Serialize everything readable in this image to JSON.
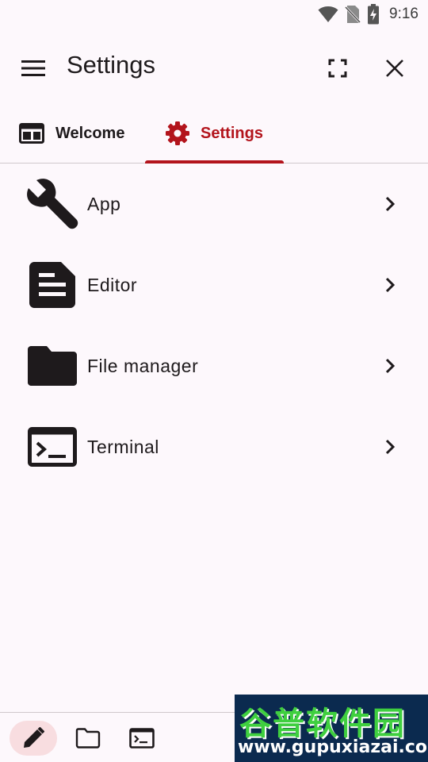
{
  "status_bar": {
    "time": "9:16",
    "icons": [
      "wifi-icon",
      "no-sim-icon",
      "battery-charging-icon"
    ]
  },
  "app_bar": {
    "title": "Settings",
    "icons": [
      "menu-icon",
      "fullscreen-icon",
      "close-icon"
    ]
  },
  "tabs": [
    {
      "label": "Welcome",
      "icon": "welcome-window-icon",
      "selected": false
    },
    {
      "label": "Settings",
      "icon": "gear-icon",
      "selected": true
    }
  ],
  "settings_items": [
    {
      "label": "App",
      "icon": "wrench-icon"
    },
    {
      "label": "Editor",
      "icon": "document-icon"
    },
    {
      "label": "File manager",
      "icon": "folder-icon"
    },
    {
      "label": "Terminal",
      "icon": "terminal-icon"
    }
  ],
  "bottom_bar": {
    "items": [
      "pencil-icon",
      "folder-outline-icon",
      "terminal-outline-icon"
    ],
    "selected": 0
  },
  "watermark": {
    "title": "谷普软件园",
    "url": "www.gupuxiazai.com"
  },
  "colors": {
    "accent": "#b3141c",
    "background": "#fdf8fc",
    "text": "#1e1a1c",
    "selected_pill": "#f8dde0"
  }
}
